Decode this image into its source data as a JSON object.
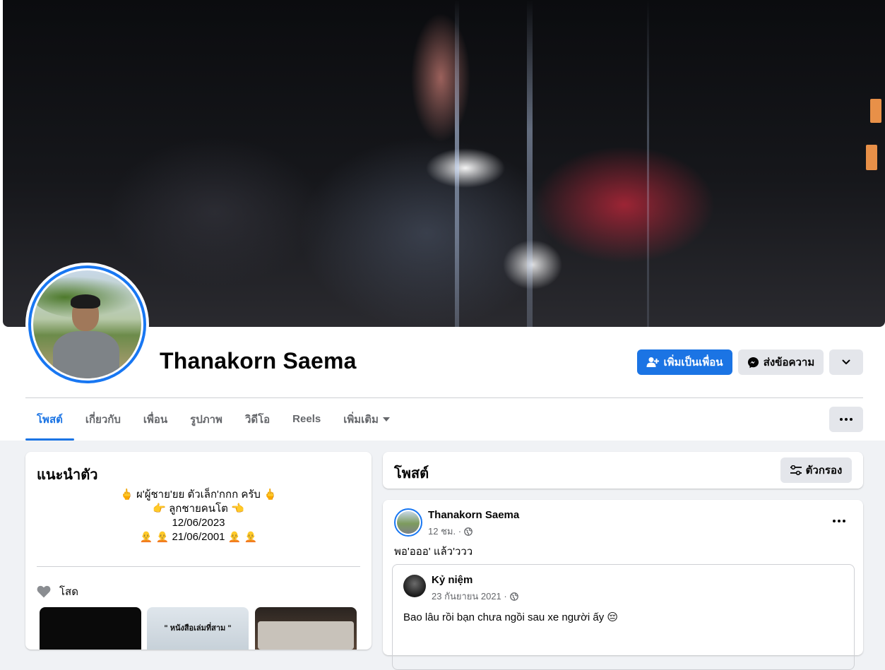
{
  "profile": {
    "name": "Thanakorn Saema",
    "add_friend_label": "เพิ่มเป็นเพื่อน",
    "message_label": "ส่งข้อความ"
  },
  "tabs": [
    {
      "label": "โพสต์",
      "active": true
    },
    {
      "label": "เกี่ยวกับ",
      "active": false
    },
    {
      "label": "เพื่อน",
      "active": false
    },
    {
      "label": "รูปภาพ",
      "active": false
    },
    {
      "label": "วิดีโอ",
      "active": false
    },
    {
      "label": "Reels",
      "active": false
    },
    {
      "label": "เพิ่มเติม",
      "active": false
    }
  ],
  "intro": {
    "title": "แนะนำตัว",
    "bio_lines": [
      "🖕 ผ'ผู้ชาย'ยย ตัวเล็ก'กกก ครับ 🖕",
      "👉 ลูกชายคนโต 👈",
      "12/06/2023",
      "🧑‍🦲 🧑‍🦲 21/06/2001 🧑‍🦲 🧑‍🦲"
    ],
    "relationship": "โสด",
    "photo_caption": "\" หนังสือเล่มที่สาม \""
  },
  "posts_header": {
    "title": "โพสต์",
    "filter_label": "ตัวกรอง"
  },
  "post": {
    "author": "Thanakorn Saema",
    "time": "12 ชม. ·",
    "text": "พอ'อออ' แล้ว'ววว",
    "shared": {
      "author": "Kỷ niệm",
      "time": "23 กันยายน 2021 ·",
      "text": "Bao lâu rồi bạn chưa ngồi sau xe người ấy 😔"
    }
  },
  "colors": {
    "accent": "#1b74e4",
    "secondary_bg": "#e4e6eb",
    "page_bg": "#f0f2f5",
    "muted_text": "#65676b"
  }
}
